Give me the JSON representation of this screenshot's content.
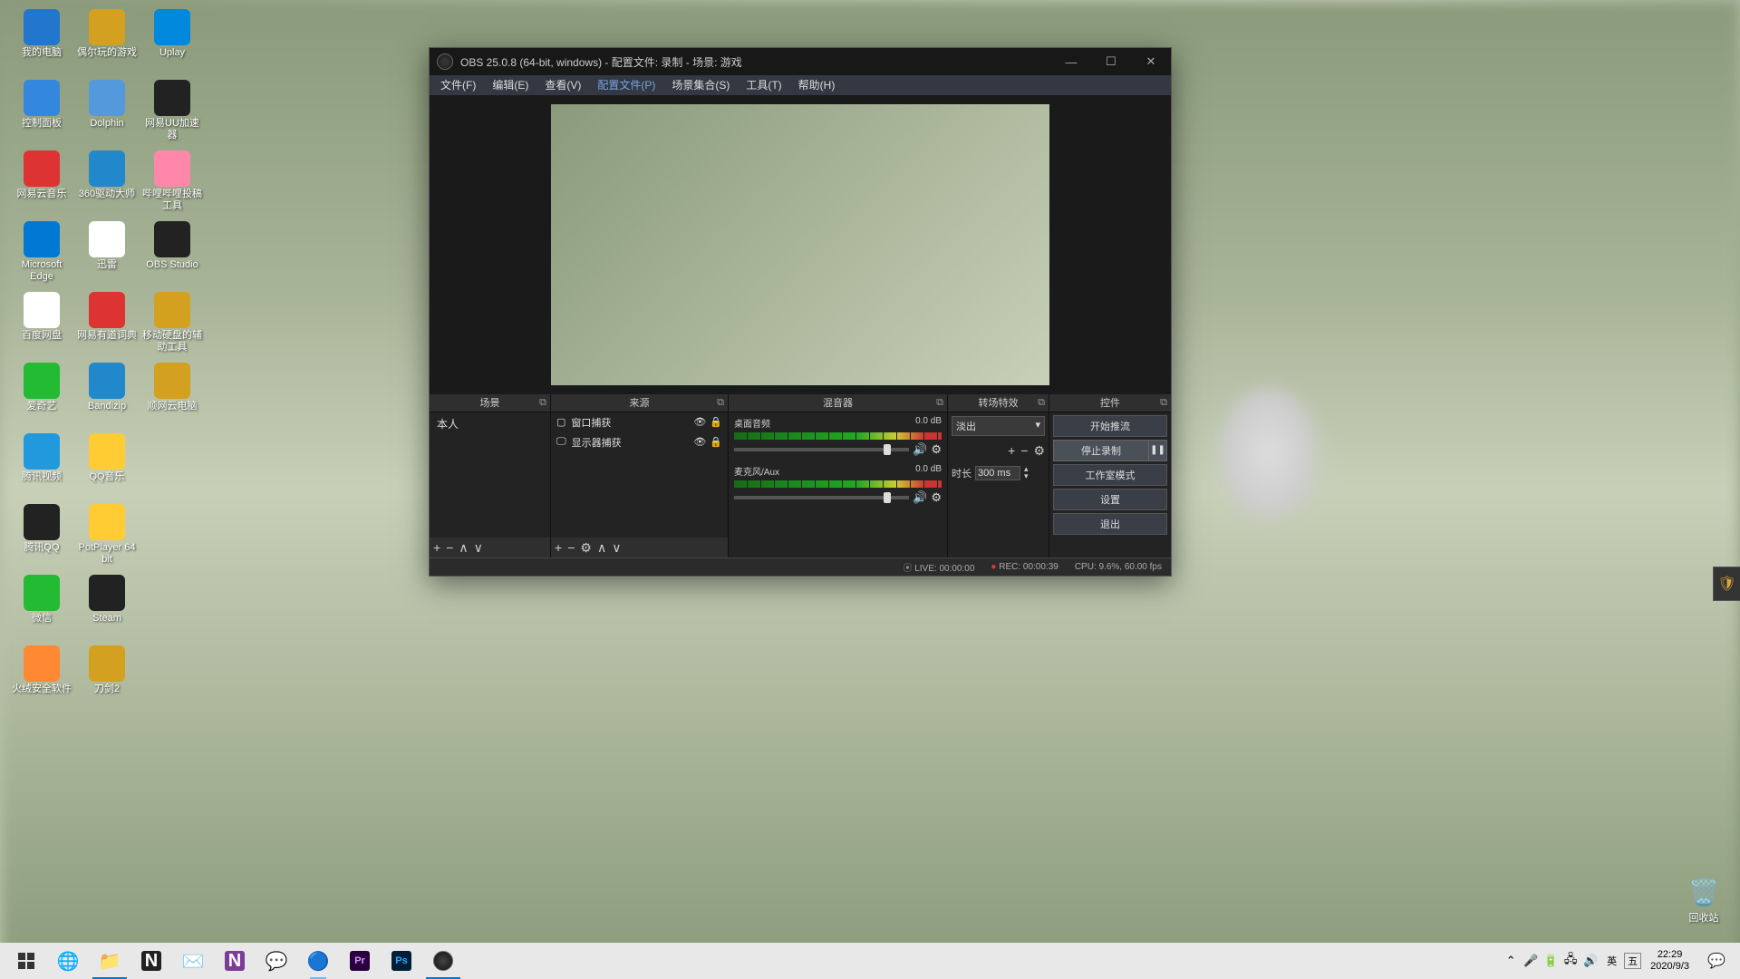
{
  "desktop": {
    "icons": [
      {
        "label": "我的电脑",
        "color": "#2277cc"
      },
      {
        "label": "偶尔玩的游戏",
        "color": "#d4a020"
      },
      {
        "label": "Uplay",
        "color": "#0088dd"
      },
      {
        "label": "控制面板",
        "color": "#3388dd"
      },
      {
        "label": "Dolphin",
        "color": "#5599dd"
      },
      {
        "label": "网易UU加速器",
        "color": "#222"
      },
      {
        "label": "网易云音乐",
        "color": "#d33"
      },
      {
        "label": "360驱动大师",
        "color": "#2288cc"
      },
      {
        "label": "哔哩哔哩投稿工具",
        "color": "#f8a"
      },
      {
        "label": "Microsoft Edge",
        "color": "#0078d4"
      },
      {
        "label": "迅雷",
        "color": "#fff"
      },
      {
        "label": "OBS Studio",
        "color": "#222"
      },
      {
        "label": "百度网盘",
        "color": "#fff"
      },
      {
        "label": "网易有道词典",
        "color": "#d33"
      },
      {
        "label": "移动硬盘的辅助工具",
        "color": "#d4a020"
      },
      {
        "label": "爱奇艺",
        "color": "#2b3"
      },
      {
        "label": "Bandizip",
        "color": "#28c"
      },
      {
        "label": "顺网云电脑",
        "color": "#d4a020"
      },
      {
        "label": "腾讯视频",
        "color": "#29d"
      },
      {
        "label": "QQ音乐",
        "color": "#fc3"
      },
      {
        "label": "",
        "color": "transparent"
      },
      {
        "label": "腾讯QQ",
        "color": "#222"
      },
      {
        "label": "PotPlayer 64 bit",
        "color": "#fc3"
      },
      {
        "label": "",
        "color": "transparent"
      },
      {
        "label": "微信",
        "color": "#2b3"
      },
      {
        "label": "Steam",
        "color": "#222"
      },
      {
        "label": "",
        "color": "transparent"
      },
      {
        "label": "火绒安全软件",
        "color": "#f83"
      },
      {
        "label": "刀剑2",
        "color": "#d4a020"
      }
    ],
    "recycleBin": "回收站"
  },
  "obs": {
    "title": "OBS 25.0.8 (64-bit, windows) - 配置文件: 录制 - 场景: 游戏",
    "menu": {
      "file": "文件(F)",
      "edit": "编辑(E)",
      "view": "查看(V)",
      "profile": "配置文件(P)",
      "sceneCollection": "场景集合(S)",
      "tools": "工具(T)",
      "help": "帮助(H)"
    },
    "docks": {
      "scenes": {
        "title": "场景",
        "items": [
          "本人"
        ]
      },
      "sources": {
        "title": "来源",
        "items": [
          {
            "name": "窗口捕获",
            "icon": "▢"
          },
          {
            "name": "显示器捕获",
            "icon": "🖵"
          }
        ]
      },
      "mixer": {
        "title": "混音器",
        "channels": [
          {
            "name": "桌面音频",
            "db": "0.0 dB"
          },
          {
            "name": "麦克风/Aux",
            "db": "0.0 dB"
          }
        ]
      },
      "transitions": {
        "title": "转场特效",
        "selected": "淡出",
        "durationLabel": "时长",
        "duration": "300 ms"
      },
      "controls": {
        "title": "控件",
        "startStream": "开始推流",
        "stopRecord": "停止录制",
        "studioMode": "工作室模式",
        "settings": "设置",
        "exit": "退出"
      }
    },
    "status": {
      "live": "LIVE: 00:00:00",
      "rec": "REC: 00:00:39",
      "cpu": "CPU: 9.6%, 60.00 fps"
    }
  },
  "taskbar": {
    "ime1": "英",
    "ime2": "五",
    "time": "22:29",
    "date": "2020/9/3"
  }
}
